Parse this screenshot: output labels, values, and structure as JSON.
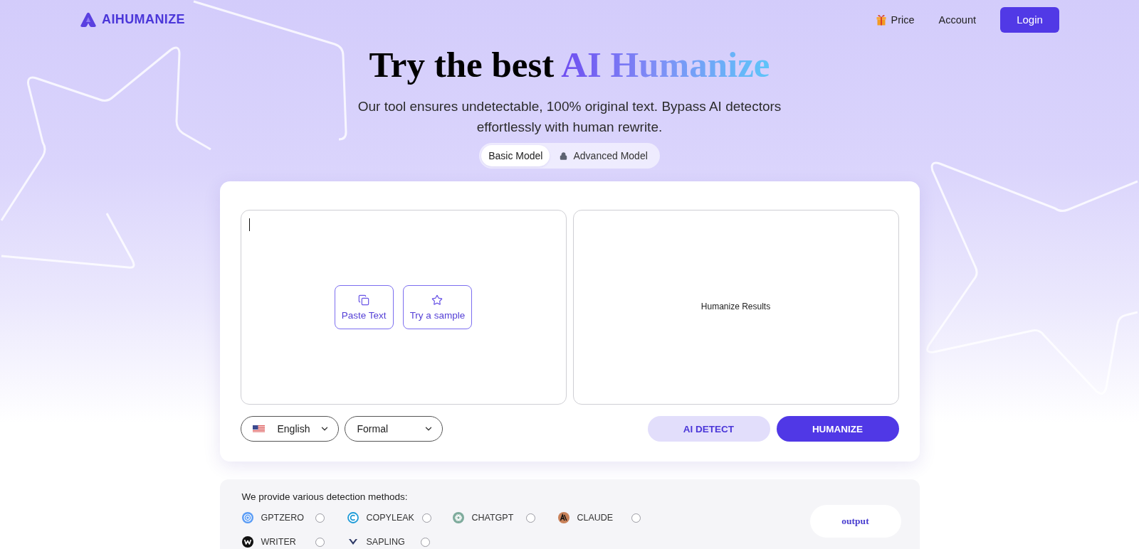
{
  "header": {
    "logo": "AIHUMANIZE",
    "price": "Price",
    "account": "Account",
    "login": "Login"
  },
  "hero": {
    "title_lead": "Try the best",
    "title_highlight": "AI Humanize",
    "subtitle": "Our tool ensures undetectable, 100% original text. Bypass AI detectors effortlessly with human rewrite."
  },
  "model_tabs": [
    {
      "label": "Basic Model",
      "selected": true,
      "locked": false
    },
    {
      "label": "Advanced Model",
      "selected": false,
      "locked": true
    }
  ],
  "editor": {
    "input_buttons": [
      {
        "label": "Paste Text"
      },
      {
        "label": "Try a sample"
      }
    ],
    "output": {
      "placeholder": "Humanize Results"
    }
  },
  "controls": {
    "language": "English",
    "tone": "Formal",
    "actions": [
      {
        "label": "AI DETECT",
        "kind": "secondary"
      },
      {
        "label": "HUMANIZE",
        "kind": "primary"
      }
    ]
  },
  "detection": {
    "heading": "We provide various detection methods:",
    "methods": [
      {
        "label": "GPTZERO",
        "selected": false
      },
      {
        "label": "COPYLEAK",
        "selected": false
      },
      {
        "label": "CHATGPT",
        "selected": false
      },
      {
        "label": "CLAUDE",
        "selected": false
      },
      {
        "label": "WRITER",
        "selected": false
      },
      {
        "label": "SAPLING",
        "selected": false
      }
    ],
    "output_button": "output"
  }
}
